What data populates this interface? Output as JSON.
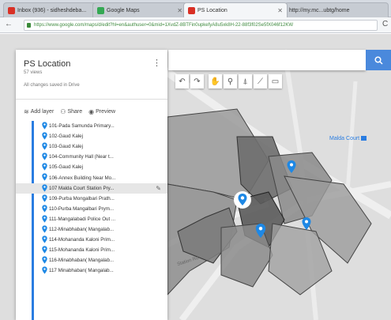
{
  "browser": {
    "tabs": [
      {
        "title": "Inbox (936) - sidheshdeba...",
        "active": false
      },
      {
        "title": "Google Maps",
        "active": false
      },
      {
        "title": "PS Location",
        "active": true
      },
      {
        "title": "http://my.mc...ubtg/home",
        "active": false
      }
    ],
    "url": "https://www.google.com/maps/d/edit?hl=en&authuser=0&mid=1XvdZ-8BTFin0upkefyA8u5xk8H-22-88f3f02Se5fX046f12KW",
    "colors": {
      "tab_red": "#d93025",
      "accent_blue": "#4a89dc"
    }
  },
  "map": {
    "search_placeholder": "",
    "tool_icons": [
      "undo-icon",
      "redo-icon",
      "hand-icon",
      "marker-icon",
      "polygon-icon",
      "route-icon",
      "ruler-icon"
    ],
    "labels": {
      "court": "Malda Court",
      "road_1": "Station Rd",
      "road_2": "Rd"
    },
    "colors": {
      "polygon_fill": "#8d8d8d",
      "polygon_dark": "#5a5a5a",
      "marker_blue": "#1e88e5"
    }
  },
  "panel": {
    "title": "PS Location",
    "views": "57 views",
    "saved_status": "All changes saved in Drive",
    "actions": {
      "add_layer": "Add layer",
      "share": "Share",
      "preview": "Preview"
    },
    "layers": [
      "101-Pada Samunda Primary...",
      "102-Gaud Kalej",
      "103-Gaud Kalej",
      "104-Community Hall (Near t...",
      "105-Gaud Kalej",
      "106-Annex Building Near Mo...",
      "107 Malda Court Station Pry...",
      "109-Purba Mongalbari Prath...",
      "110-Purba Mangalbari Prym...",
      "111-Mangalabadi Police Out ...",
      "112-Minabhaban( Mangalab...",
      "114-Mohananda Kaloni Prim...",
      "115-Mohananda Kaloni Prim...",
      "116-Minabhaban( Mangalab...",
      "117 Minabhaban( Mangalab..."
    ],
    "selected_index": 6
  }
}
